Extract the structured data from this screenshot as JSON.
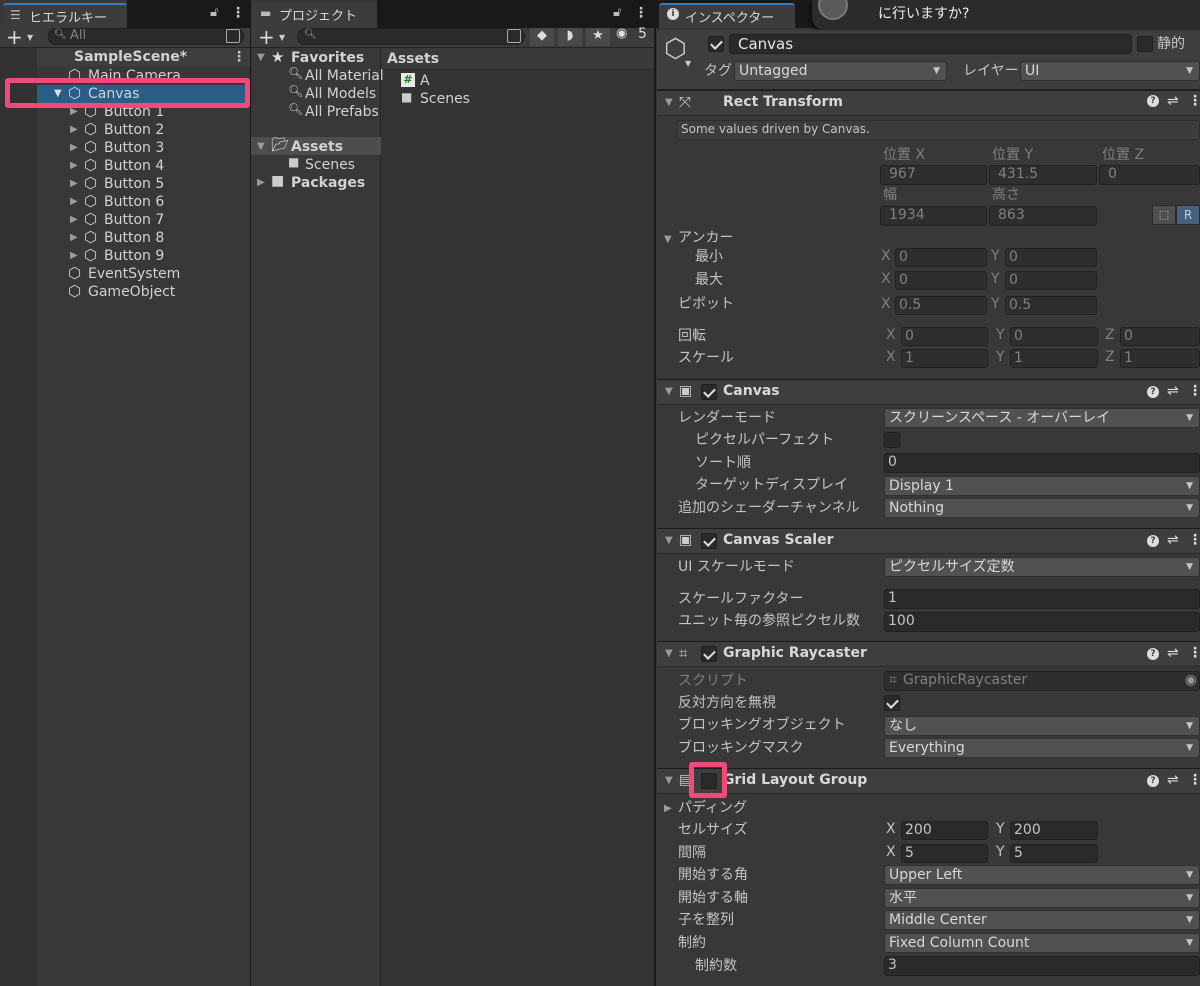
{
  "hierarchy": {
    "tab_label": "ヒエラルキー",
    "search_placeholder": "All",
    "scene": "SampleScene*",
    "items": [
      "Main Camera",
      "Canvas",
      "Button 1",
      "Button 2",
      "Button 3",
      "Button 4",
      "Button 5",
      "Button 6",
      "Button 7",
      "Button 8",
      "Button 9",
      "EventSystem",
      "GameObject"
    ]
  },
  "project": {
    "tab_label": "プロジェクト",
    "badge": "5",
    "tree": [
      "Favorites",
      "All Material",
      "All Models",
      "All Prefabs",
      "Assets",
      "Scenes",
      "Packages"
    ],
    "assets_header": "Assets",
    "assets": [
      "A",
      "Scenes"
    ]
  },
  "inspector": {
    "tab_label": "インスペクター",
    "notification": "に行いますか?",
    "object_name": "Canvas",
    "static_label": "静的",
    "tag_label": "タグ",
    "tag_value": "Untagged",
    "layer_label": "レイヤー",
    "layer_value": "UI",
    "rect": {
      "title": "Rect Transform",
      "note": "Some values driven by Canvas.",
      "posx_label": "位置 X",
      "posy_label": "位置 Y",
      "posz_label": "位置 Z",
      "posx": "967",
      "posy": "431.5",
      "posz": "0",
      "w_label": "幅",
      "h_label": "高さ",
      "w": "1934",
      "h": "863",
      "anchor_label": "アンカー",
      "min_label": "最小",
      "max_label": "最大",
      "min_x": "0",
      "min_y": "0",
      "max_x": "0",
      "max_y": "0",
      "pivot_label": "ピボット",
      "pivot_x": "0.5",
      "pivot_y": "0.5",
      "rot_label": "回転",
      "rot_x": "0",
      "rot_y": "0",
      "rot_z": "0",
      "scale_label": "スケール",
      "scale_x": "1",
      "scale_y": "1",
      "scale_z": "1",
      "r_label": "R"
    },
    "canvas": {
      "title": "Canvas",
      "render_mode_label": "レンダーモード",
      "render_mode": "スクリーンスペース - オーバーレイ",
      "pixel_perfect_label": "ピクセルパーフェクト",
      "sort_label": "ソート順",
      "sort": "0",
      "target_label": "ターゲットディスプレイ",
      "target": "Display 1",
      "shader_label": "追加のシェーダーチャンネル",
      "shader": "Nothing"
    },
    "scaler": {
      "title": "Canvas Scaler",
      "mode_label": "UI スケールモード",
      "mode": "ピクセルサイズ定数",
      "factor_label": "スケールファクター",
      "factor": "1",
      "ppu_label": "ユニット毎の参照ピクセル数",
      "ppu": "100"
    },
    "raycaster": {
      "title": "Graphic Raycaster",
      "script_label": "スクリプト",
      "script": "GraphicRaycaster",
      "ignore_label": "反対方向を無視",
      "block_obj_label": "ブロッキングオブジェクト",
      "block_obj": "なし",
      "block_mask_label": "ブロッキングマスク",
      "block_mask": "Everything"
    },
    "grid": {
      "title": "Grid Layout Group",
      "padding_label": "パディング",
      "cell_label": "セルサイズ",
      "cell_x": "200",
      "cell_y": "200",
      "spacing_label": "間隔",
      "spacing_x": "5",
      "spacing_y": "5",
      "start_corner_label": "開始する角",
      "start_corner": "Upper Left",
      "start_axis_label": "開始する軸",
      "start_axis": "水平",
      "child_align_label": "子を整列",
      "child_align": "Middle Center",
      "constraint_label": "制約",
      "constraint": "Fixed Column Count",
      "constraint_count_label": "制約数",
      "constraint_count": "3"
    }
  },
  "axes": {
    "x": "X",
    "y": "Y",
    "z": "Z"
  }
}
